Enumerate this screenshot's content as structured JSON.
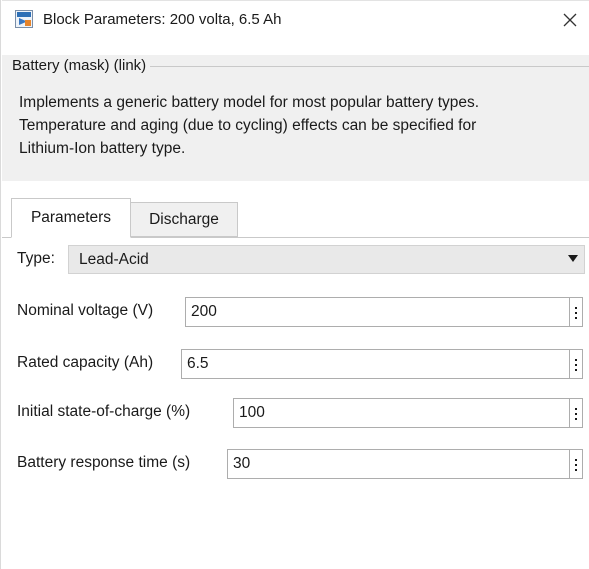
{
  "window": {
    "title": "Block Parameters: 200 volta, 6.5 Ah",
    "title_icon": "simulink-block-icon",
    "close_icon": "close-icon"
  },
  "description": {
    "group_label": "Battery (mask) (link)",
    "lines": [
      "Implements a generic battery model for most popular battery types.",
      "Temperature and aging (due to cycling) effects can be specified for",
      "Lithium-Ion battery type."
    ]
  },
  "tabs": [
    {
      "label": "Parameters",
      "active": true
    },
    {
      "label": "Discharge",
      "active": false
    }
  ],
  "params": {
    "type": {
      "label": "Type:",
      "value": "Lead-Acid"
    },
    "fields": [
      {
        "label": "Nominal voltage (V)",
        "value": "200"
      },
      {
        "label": "Rated capacity (Ah)",
        "value": "6.5"
      },
      {
        "label": "Initial state-of-charge (%)",
        "value": "100"
      },
      {
        "label": "Battery response time (s)",
        "value": "30"
      }
    ]
  },
  "colors": {
    "panel_bg": "#f0f0f0",
    "border": "#adadad",
    "text": "#1a1a1a"
  }
}
